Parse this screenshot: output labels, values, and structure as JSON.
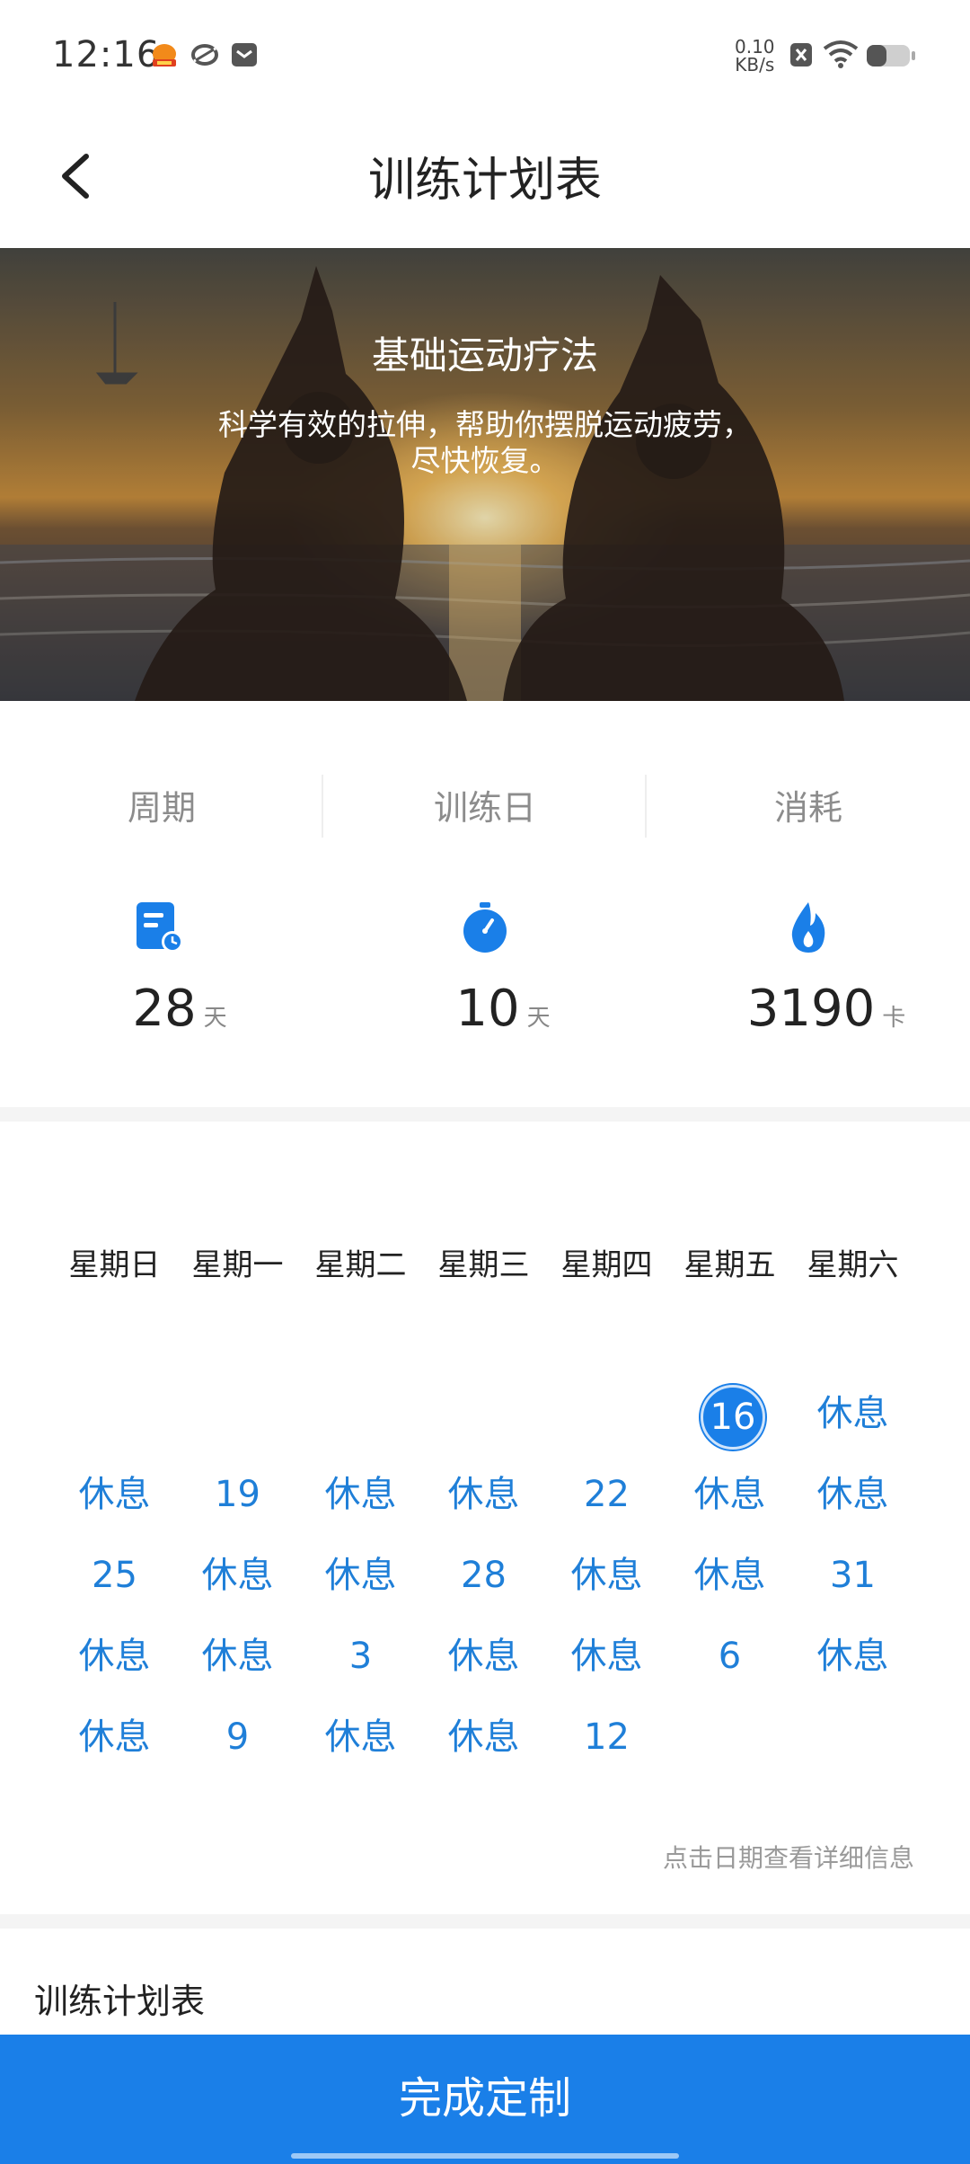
{
  "status_bar": {
    "time": "12:16",
    "net_speed_value": "0.10",
    "net_speed_unit": "KB/s"
  },
  "header": {
    "title": "训练计划表"
  },
  "hero": {
    "title": "基础运动疗法",
    "subtitle_line1": "科学有效的拉伸，帮助你摆脱运动疲劳，",
    "subtitle_line2": "尽快恢复。"
  },
  "stats": [
    {
      "label": "周期",
      "value": "28",
      "unit": "天",
      "icon": "document-clock-icon"
    },
    {
      "label": "训练日",
      "value": "10",
      "unit": "天",
      "icon": "stopwatch-icon"
    },
    {
      "label": "消耗",
      "value": "3190",
      "unit": "卡",
      "icon": "flame-icon"
    }
  ],
  "calendar": {
    "weekdays": [
      "星期日",
      "星期一",
      "星期二",
      "星期三",
      "星期四",
      "星期五",
      "星期六"
    ],
    "today": "16",
    "rows": [
      [
        "",
        "",
        "",
        "",
        "",
        "16",
        "休息"
      ],
      [
        "休息",
        "19",
        "休息",
        "休息",
        "22",
        "休息",
        "休息"
      ],
      [
        "25",
        "休息",
        "休息",
        "28",
        "休息",
        "休息",
        "31"
      ],
      [
        "休息",
        "休息",
        "3",
        "休息",
        "休息",
        "6",
        "休息"
      ],
      [
        "休息",
        "9",
        "休息",
        "休息",
        "12",
        "",
        ""
      ]
    ],
    "hint": "点击日期查看详细信息"
  },
  "section": {
    "title": "训练计划表"
  },
  "footer": {
    "button_label": "完成定制"
  },
  "colors": {
    "accent": "#1a7fe8",
    "calendar_text": "#1f7fd8"
  }
}
